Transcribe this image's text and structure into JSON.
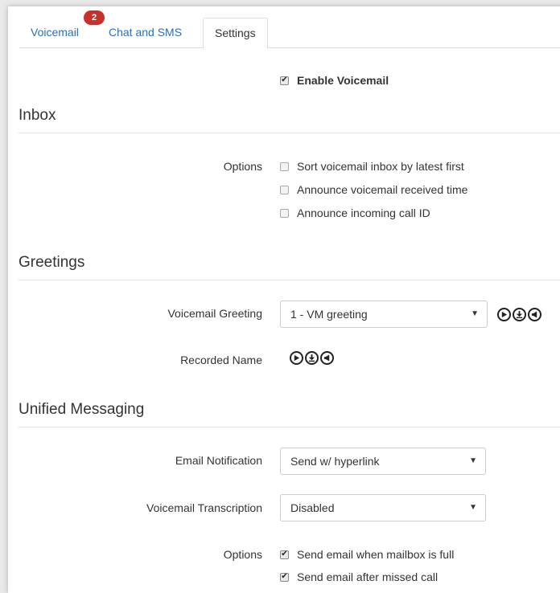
{
  "tabs": [
    {
      "label": "Voicemail",
      "badge": "2"
    },
    {
      "label": "Chat and SMS"
    },
    {
      "label": "Settings"
    }
  ],
  "enable_voicemail": {
    "label": "Enable Voicemail",
    "checked": true
  },
  "inbox": {
    "title": "Inbox",
    "options_label": "Options",
    "options": [
      {
        "label": "Sort voicemail inbox by latest first",
        "checked": false
      },
      {
        "label": "Announce voicemail received time",
        "checked": false
      },
      {
        "label": "Announce incoming call ID",
        "checked": false
      }
    ]
  },
  "greetings": {
    "title": "Greetings",
    "voicemail_greeting_label": "Voicemail Greeting",
    "voicemail_greeting_value": "1 - VM greeting",
    "recorded_name_label": "Recorded Name"
  },
  "unified": {
    "title": "Unified Messaging",
    "email_notification_label": "Email Notification",
    "email_notification_value": "Send w/ hyperlink",
    "transcription_label": "Voicemail Transcription",
    "transcription_value": "Disabled",
    "options_label": "Options",
    "options": [
      {
        "label": "Send email when mailbox is full",
        "checked": true
      },
      {
        "label": "Send email after missed call",
        "checked": true
      }
    ]
  },
  "colors": {
    "link": "#2a6ebb",
    "badge": "#c9302c"
  },
  "icons": {
    "play": "play-icon",
    "download": "download-icon",
    "speaker": "speaker-icon"
  }
}
